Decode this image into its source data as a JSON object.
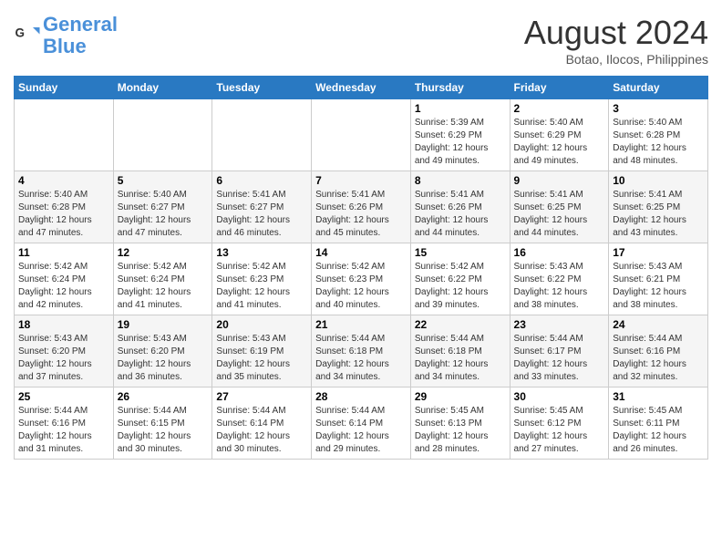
{
  "logo": {
    "line1": "General",
    "line2": "Blue"
  },
  "title": "August 2024",
  "location": "Botao, Ilocos, Philippines",
  "weekdays": [
    "Sunday",
    "Monday",
    "Tuesday",
    "Wednesday",
    "Thursday",
    "Friday",
    "Saturday"
  ],
  "weeks": [
    [
      null,
      null,
      null,
      null,
      {
        "day": "1",
        "sunrise": "5:39 AM",
        "sunset": "6:29 PM",
        "daylight": "12 hours and 49 minutes."
      },
      {
        "day": "2",
        "sunrise": "5:40 AM",
        "sunset": "6:29 PM",
        "daylight": "12 hours and 49 minutes."
      },
      {
        "day": "3",
        "sunrise": "5:40 AM",
        "sunset": "6:28 PM",
        "daylight": "12 hours and 48 minutes."
      }
    ],
    [
      {
        "day": "4",
        "sunrise": "5:40 AM",
        "sunset": "6:28 PM",
        "daylight": "12 hours and 47 minutes."
      },
      {
        "day": "5",
        "sunrise": "5:40 AM",
        "sunset": "6:27 PM",
        "daylight": "12 hours and 47 minutes."
      },
      {
        "day": "6",
        "sunrise": "5:41 AM",
        "sunset": "6:27 PM",
        "daylight": "12 hours and 46 minutes."
      },
      {
        "day": "7",
        "sunrise": "5:41 AM",
        "sunset": "6:26 PM",
        "daylight": "12 hours and 45 minutes."
      },
      {
        "day": "8",
        "sunrise": "5:41 AM",
        "sunset": "6:26 PM",
        "daylight": "12 hours and 44 minutes."
      },
      {
        "day": "9",
        "sunrise": "5:41 AM",
        "sunset": "6:25 PM",
        "daylight": "12 hours and 44 minutes."
      },
      {
        "day": "10",
        "sunrise": "5:41 AM",
        "sunset": "6:25 PM",
        "daylight": "12 hours and 43 minutes."
      }
    ],
    [
      {
        "day": "11",
        "sunrise": "5:42 AM",
        "sunset": "6:24 PM",
        "daylight": "12 hours and 42 minutes."
      },
      {
        "day": "12",
        "sunrise": "5:42 AM",
        "sunset": "6:24 PM",
        "daylight": "12 hours and 41 minutes."
      },
      {
        "day": "13",
        "sunrise": "5:42 AM",
        "sunset": "6:23 PM",
        "daylight": "12 hours and 41 minutes."
      },
      {
        "day": "14",
        "sunrise": "5:42 AM",
        "sunset": "6:23 PM",
        "daylight": "12 hours and 40 minutes."
      },
      {
        "day": "15",
        "sunrise": "5:42 AM",
        "sunset": "6:22 PM",
        "daylight": "12 hours and 39 minutes."
      },
      {
        "day": "16",
        "sunrise": "5:43 AM",
        "sunset": "6:22 PM",
        "daylight": "12 hours and 38 minutes."
      },
      {
        "day": "17",
        "sunrise": "5:43 AM",
        "sunset": "6:21 PM",
        "daylight": "12 hours and 38 minutes."
      }
    ],
    [
      {
        "day": "18",
        "sunrise": "5:43 AM",
        "sunset": "6:20 PM",
        "daylight": "12 hours and 37 minutes."
      },
      {
        "day": "19",
        "sunrise": "5:43 AM",
        "sunset": "6:20 PM",
        "daylight": "12 hours and 36 minutes."
      },
      {
        "day": "20",
        "sunrise": "5:43 AM",
        "sunset": "6:19 PM",
        "daylight": "12 hours and 35 minutes."
      },
      {
        "day": "21",
        "sunrise": "5:44 AM",
        "sunset": "6:18 PM",
        "daylight": "12 hours and 34 minutes."
      },
      {
        "day": "22",
        "sunrise": "5:44 AM",
        "sunset": "6:18 PM",
        "daylight": "12 hours and 34 minutes."
      },
      {
        "day": "23",
        "sunrise": "5:44 AM",
        "sunset": "6:17 PM",
        "daylight": "12 hours and 33 minutes."
      },
      {
        "day": "24",
        "sunrise": "5:44 AM",
        "sunset": "6:16 PM",
        "daylight": "12 hours and 32 minutes."
      }
    ],
    [
      {
        "day": "25",
        "sunrise": "5:44 AM",
        "sunset": "6:16 PM",
        "daylight": "12 hours and 31 minutes."
      },
      {
        "day": "26",
        "sunrise": "5:44 AM",
        "sunset": "6:15 PM",
        "daylight": "12 hours and 30 minutes."
      },
      {
        "day": "27",
        "sunrise": "5:44 AM",
        "sunset": "6:14 PM",
        "daylight": "12 hours and 30 minutes."
      },
      {
        "day": "28",
        "sunrise": "5:44 AM",
        "sunset": "6:14 PM",
        "daylight": "12 hours and 29 minutes."
      },
      {
        "day": "29",
        "sunrise": "5:45 AM",
        "sunset": "6:13 PM",
        "daylight": "12 hours and 28 minutes."
      },
      {
        "day": "30",
        "sunrise": "5:45 AM",
        "sunset": "6:12 PM",
        "daylight": "12 hours and 27 minutes."
      },
      {
        "day": "31",
        "sunrise": "5:45 AM",
        "sunset": "6:11 PM",
        "daylight": "12 hours and 26 minutes."
      }
    ]
  ]
}
